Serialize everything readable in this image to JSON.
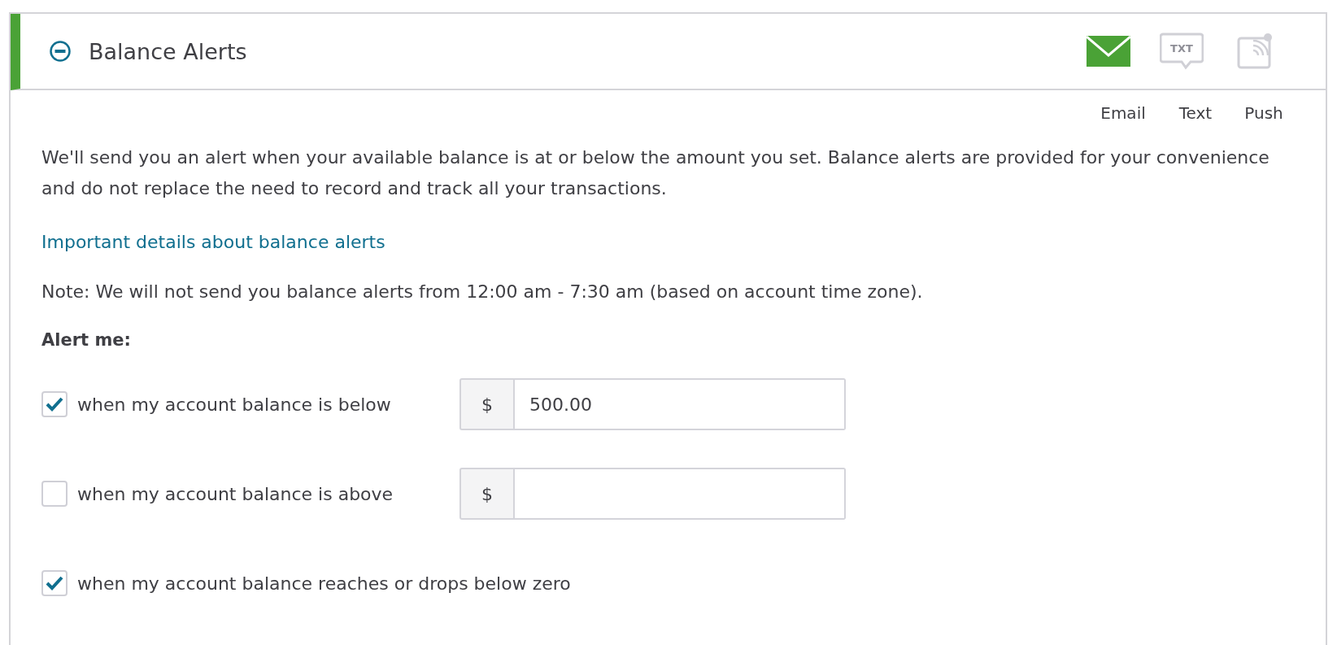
{
  "panel": {
    "title": "Balance Alerts",
    "expanded": true
  },
  "channels": [
    {
      "kind": "email",
      "label": "Email",
      "selected": true
    },
    {
      "kind": "text",
      "label": "Text",
      "selected": false,
      "icon_label": "TXT"
    },
    {
      "kind": "push",
      "label": "Push",
      "selected": false
    }
  ],
  "description": "We'll send you an alert when your available balance is at or below the amount you set. Balance alerts are provided for your convenience and do not replace the need to record and track all your transactions.",
  "details_link": "Important details about balance alerts",
  "note": "Note: We will not send you balance alerts from 12:00 am - 7:30 am (based on account time zone).",
  "alert_heading": "Alert me:",
  "alerts": [
    {
      "kind": "amount",
      "label": "when my account balance is below",
      "checked": true,
      "prefix": "$",
      "value": "500.00"
    },
    {
      "kind": "amount",
      "label": "when my account balance is above",
      "checked": false,
      "prefix": "$"
    },
    {
      "kind": "plain",
      "label": "when my account balance reaches or drops below zero",
      "checked": true
    }
  ]
}
